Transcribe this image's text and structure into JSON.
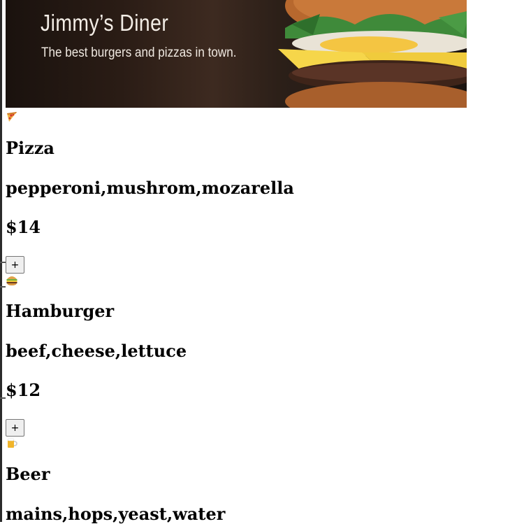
{
  "hero": {
    "title": "Jimmy’s Diner",
    "subtitle": "The best burgers and pizzas in town."
  },
  "menu": {
    "items": [
      {
        "emoji_icon": "pizza-icon",
        "name": "Pizza",
        "ingredients": "pepperoni,mushrom,mozarella",
        "price": "$14",
        "add_label": "+"
      },
      {
        "emoji_icon": "hamburger-icon",
        "name": "Hamburger",
        "ingredients": "beef,cheese,lettuce",
        "price": "$12",
        "add_label": "+"
      },
      {
        "emoji_icon": "beer-icon",
        "name": "Beer",
        "ingredients": "",
        "price": "",
        "add_label": "+"
      }
    ]
  }
}
